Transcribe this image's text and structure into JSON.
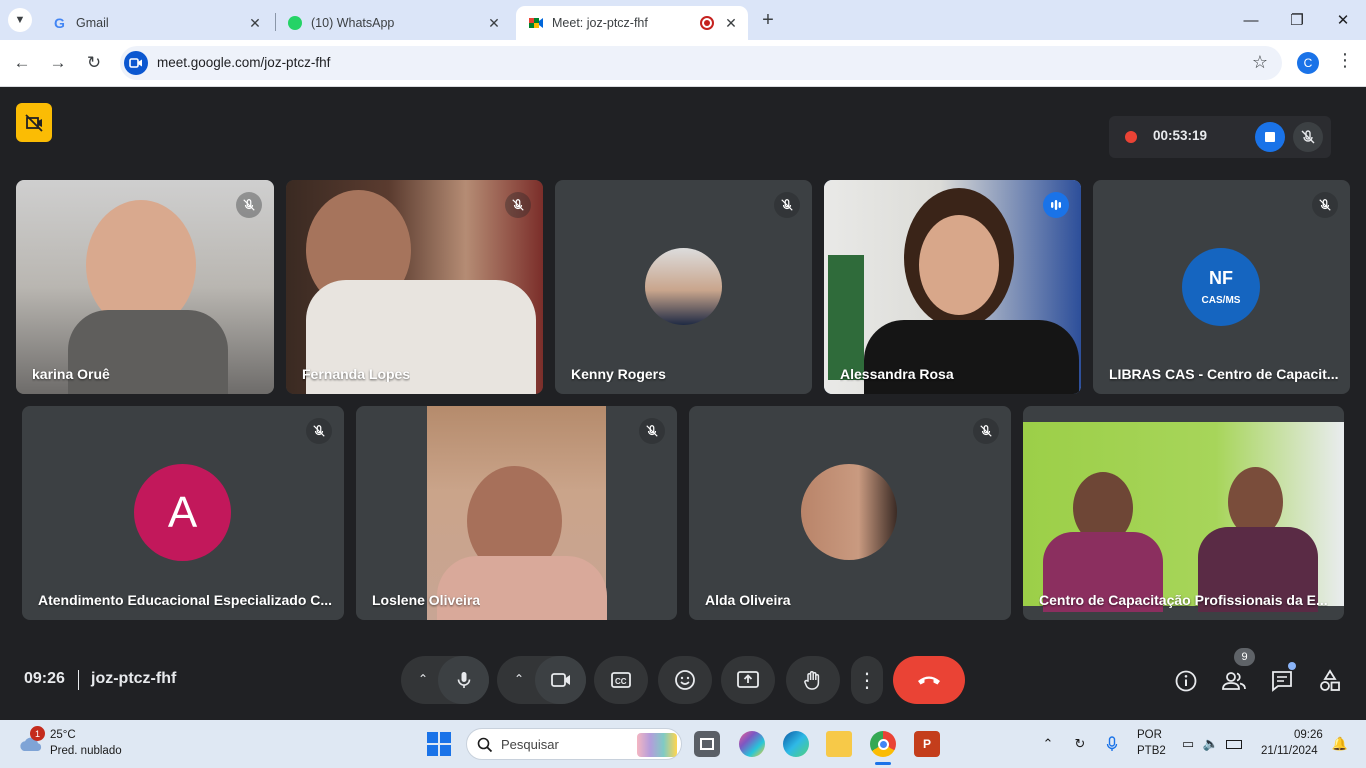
{
  "browser": {
    "tabs": [
      {
        "title": "Gmail",
        "icon": "gmail-icon"
      },
      {
        "title": "(10) WhatsApp",
        "icon": "whatsapp-icon",
        "badge": "10"
      },
      {
        "title": "Meet: joz-ptcz-fhf",
        "icon": "meet-icon",
        "active": true
      }
    ],
    "url": "meet.google.com/joz-ptcz-fhf",
    "profile_initial": "C"
  },
  "meet": {
    "recording_time": "00:53:19",
    "clock": "09:26",
    "meeting_code": "joz-ptcz-fhf",
    "participant_count": "9",
    "participants_row1": [
      {
        "name": "karina Oruê",
        "muted": true
      },
      {
        "name": "Fernanda Lopes",
        "muted": true
      },
      {
        "name": "Kenny Rogers",
        "muted": true
      },
      {
        "name": "Alessandra Rosa",
        "muted": false,
        "speaking": true
      },
      {
        "name": "LIBRAS CAS - Centro de Capacit...",
        "muted": true
      }
    ],
    "participants_row2": [
      {
        "name": "Atendimento Educacional Especializado C...",
        "muted": true
      },
      {
        "name": "Loslene Oliveira",
        "muted": true
      },
      {
        "name": "Alda Oliveira",
        "muted": true
      },
      {
        "name": "Centro de Capacitação Profissionais da E...",
        "muted": false
      }
    ],
    "avatar_letter": "A",
    "logo": {
      "line1": "NF",
      "line2": "CAS/MS"
    },
    "colors": {
      "accent": "#1a73e8",
      "end_call": "#ea4335",
      "host_badge": "#fbbc04",
      "avatar_a": "#c2185b"
    }
  },
  "taskbar": {
    "weather_badge": "1",
    "temperature": "25°C",
    "condition": "Pred. nublado",
    "search_placeholder": "Pesquisar",
    "lang_line1": "POR",
    "lang_line2": "PTB2",
    "time": "09:26",
    "date": "21/11/2024"
  }
}
